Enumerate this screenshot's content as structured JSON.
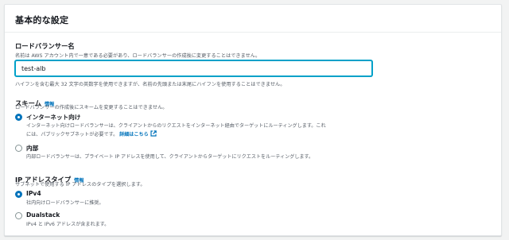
{
  "panel": {
    "title": "基本的な設定"
  },
  "lb_name": {
    "label": "ロードバランサー名",
    "description": "名前は AWS アカウント内で一意である必要があり、ロードバランサーの作成後に変更することはできません。",
    "value": "test-alb",
    "constraint": "ハイフンを含む最大 32 文字の英数字を使用できますが、名前の先頭または末尾にハイフンを使用することはできません。"
  },
  "scheme": {
    "label": "スキーム",
    "info_label": "情報",
    "description": "ロードバランサーの作成後にスキームを変更することはできません。",
    "options": [
      {
        "label": "インターネット向け",
        "selected": true,
        "description_line1": "インターネット向けロードバランサーは、クライアントからのリクエストをインターネット経由でターゲットにルーティングします。これ",
        "description_line2": "には、パブリックサブネットが必要です。",
        "link_label": "詳細はこちら"
      },
      {
        "label": "内部",
        "selected": false,
        "description_line1": "内部ロードバランサーは、プライベート IP アドレスを使用して、クライアントからターゲットにリクエストをルーティングします。"
      }
    ]
  },
  "ip_type": {
    "label": "IP アドレスタイプ",
    "info_label": "情報",
    "description": "サブネットで使用する IP アドレスのタイプを選択します。",
    "options": [
      {
        "label": "IPv4",
        "selected": true,
        "description_line1": "社内向けロードバランサーに推奨。"
      },
      {
        "label": "Dualstack",
        "selected": false,
        "description_line1": "IPv4 と IPv6 アドレスが含まれます。"
      }
    ]
  },
  "colors": {
    "accent": "#0073bb",
    "focus": "#00a1c9",
    "text": "#16191f",
    "muted": "#545b64"
  },
  "icons": {
    "external_link": "external-link-icon"
  }
}
